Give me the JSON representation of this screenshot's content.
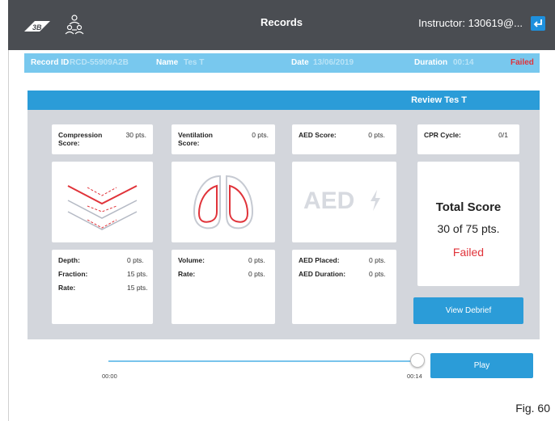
{
  "header": {
    "title": "Records",
    "instructor": "Instructor: 130619@..."
  },
  "record": {
    "id_label": "Record ID",
    "id_value": "RCD-55909A2B",
    "name_label": "Name",
    "name_value": "Tes T",
    "date_label": "Date",
    "date_value": "13/06/2019",
    "duration_label": "Duration",
    "duration_value": "00:14",
    "status": "Failed"
  },
  "review": {
    "title": "Review  Tes T",
    "compression": {
      "label": "Compression Score:",
      "points": "30 pts.",
      "details": [
        {
          "label": "Depth:",
          "value": "0 pts."
        },
        {
          "label": "Fraction:",
          "value": "15 pts."
        },
        {
          "label": "Rate:",
          "value": "15 pts."
        }
      ]
    },
    "ventilation": {
      "label": "Ventilation Score:",
      "points": "0 pts.",
      "details": [
        {
          "label": "Volume:",
          "value": "0 pts."
        },
        {
          "label": "Rate:",
          "value": "0 pts."
        }
      ]
    },
    "aed": {
      "label": "AED Score:",
      "points": "0 pts.",
      "image_text": "AED",
      "details": [
        {
          "label": "AED Placed:",
          "value": "0 pts."
        },
        {
          "label": "AED Duration:",
          "value": "0 pts."
        }
      ]
    },
    "cpr": {
      "label": "CPR Cycle:",
      "value": "0/1"
    },
    "total": {
      "title": "Total Score",
      "score": "30 of 75 pts.",
      "status": "Failed"
    },
    "debrief_label": "View Debrief"
  },
  "playback": {
    "start": "00:00",
    "end": "00:14",
    "position": 1.0,
    "play_label": "Play"
  },
  "figure_label": "Fig. 60",
  "colors": {
    "topbar": "#4a4d52",
    "accent": "#2b9cd8",
    "record_bar": "#78c8ee",
    "failed": "#e0333a",
    "panel": "#d3d6dc"
  }
}
